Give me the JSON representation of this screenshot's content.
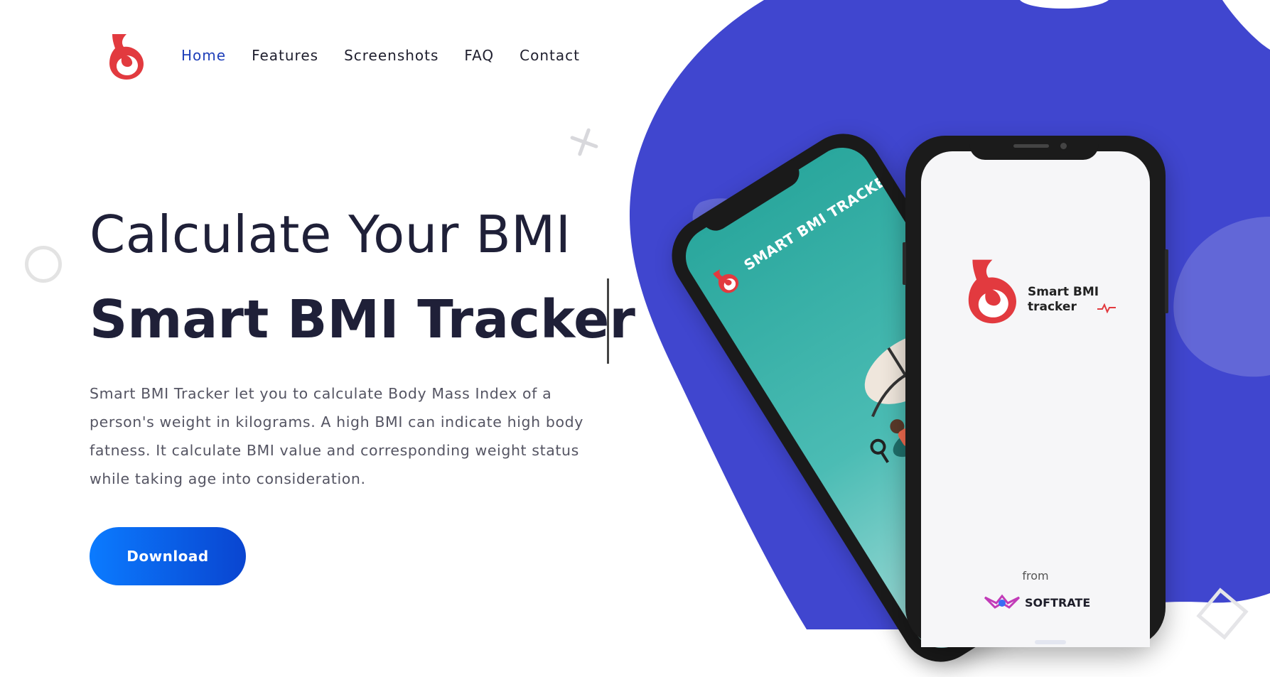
{
  "colors": {
    "accent_blue": "#4046cf",
    "nav_active": "#1e3fb9",
    "heading": "#1f2038",
    "body_text": "#555563",
    "button_gradient_start": "#0b7bff",
    "button_gradient_end": "#0a45d0",
    "logo_red": "#e23a3f",
    "phone_teal": "#2aa79d"
  },
  "header": {
    "logo_icon": "flame-drop-logo",
    "nav": [
      {
        "label": "Home",
        "active": true
      },
      {
        "label": "Features",
        "active": false
      },
      {
        "label": "Screenshots",
        "active": false
      },
      {
        "label": "FAQ",
        "active": false
      },
      {
        "label": "Contact",
        "active": false
      }
    ]
  },
  "hero": {
    "title_line1": "Calculate Your BMI",
    "title_line2": "Smart BMI Tracker",
    "description": "Smart BMI Tracker let you to calculate Body Mass Index of a person's weight in kilograms. A high BMI can indicate high body fatness. It calculate BMI value and corresponding weight status while taking age into consideration.",
    "download_label": "Download"
  },
  "phones": {
    "back_screen": {
      "app_title": "SMART BMI TRACKER"
    },
    "front_screen": {
      "app_name": "Smart BMI tracker",
      "from_label": "from",
      "brand_name": "SOFTRATE"
    }
  }
}
